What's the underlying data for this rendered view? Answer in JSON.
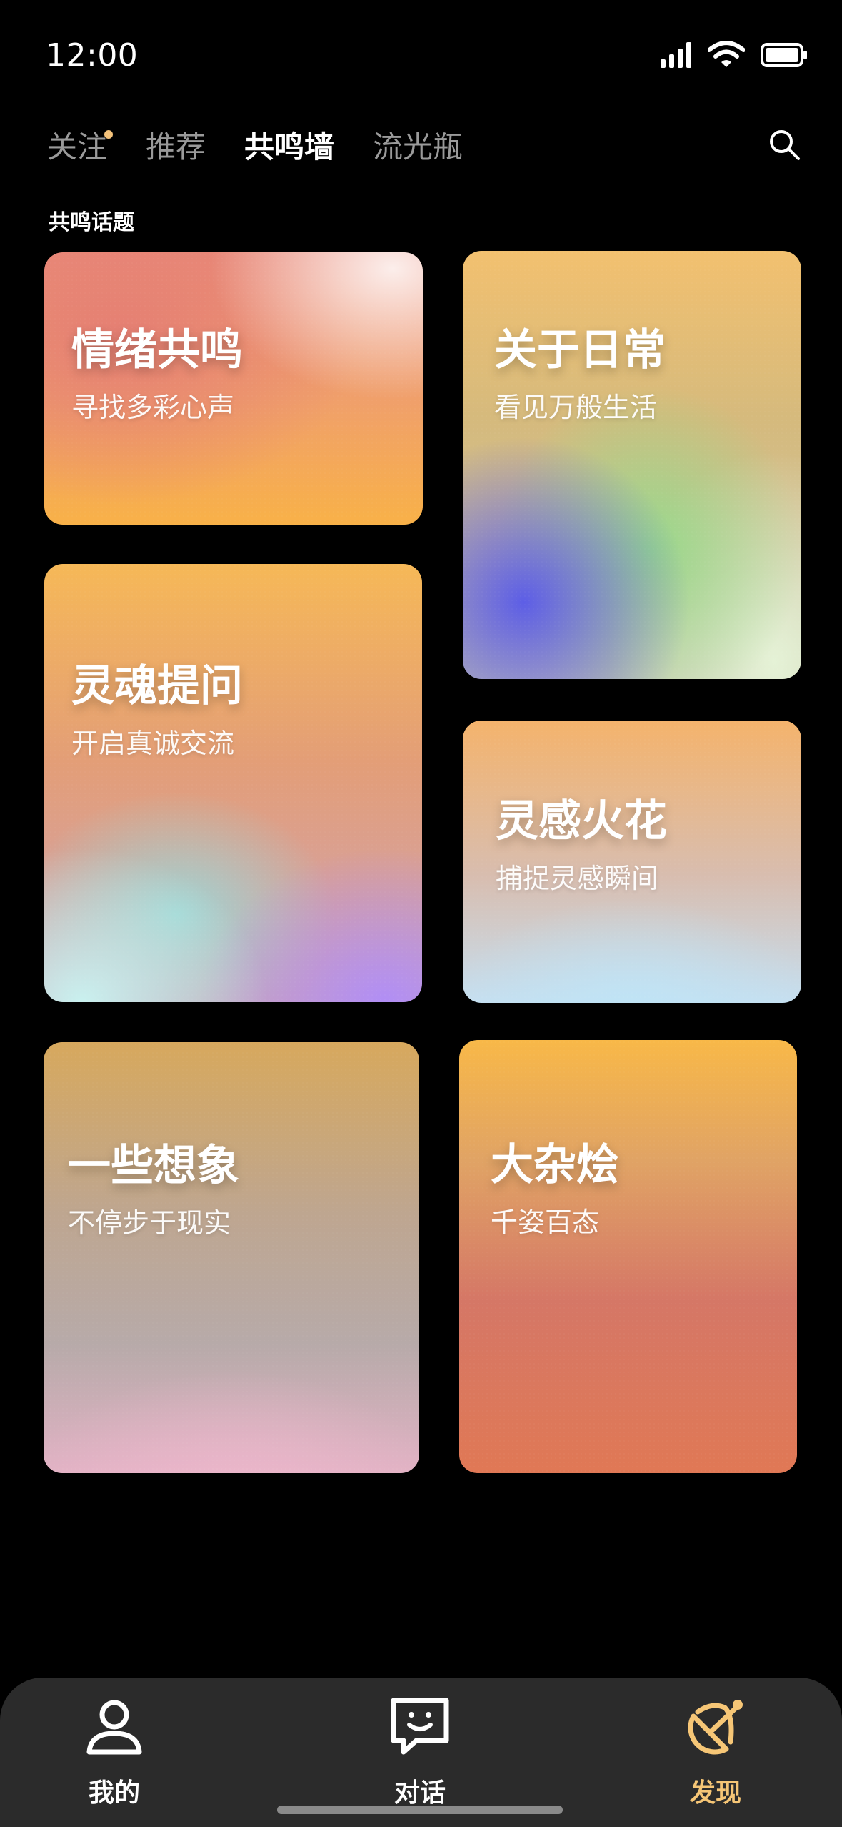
{
  "status_bar": {
    "time": "12:00",
    "icons": [
      "signal-icon",
      "wifi-icon",
      "battery-icon"
    ]
  },
  "tabs": [
    {
      "label": "关注",
      "has_dot": true
    },
    {
      "label": "推荐"
    },
    {
      "label": "共鸣墙",
      "active": true
    },
    {
      "label": "流光瓶"
    }
  ],
  "section": {
    "title": "共鸣话题"
  },
  "cards": [
    {
      "title": "情绪共鸣",
      "subtitle": "寻找多彩心声"
    },
    {
      "title": "关于日常",
      "subtitle": "看见万般生活"
    },
    {
      "title": "灵魂提问",
      "subtitle": "开启真诚交流"
    },
    {
      "title": "灵感火花",
      "subtitle": "捕捉灵感瞬间"
    },
    {
      "title": "一些想象",
      "subtitle": "不停步于现实"
    },
    {
      "title": "大杂烩",
      "subtitle": "千姿百态"
    }
  ],
  "bottom_nav": [
    {
      "label": "我的",
      "icon": "person-icon"
    },
    {
      "label": "对话",
      "icon": "chat-icon"
    },
    {
      "label": "发现",
      "icon": "discover-icon",
      "active": true
    }
  ],
  "colors": {
    "accent": "#f6c676",
    "background": "#000000",
    "tab_inactive": "#9a9a9a"
  }
}
